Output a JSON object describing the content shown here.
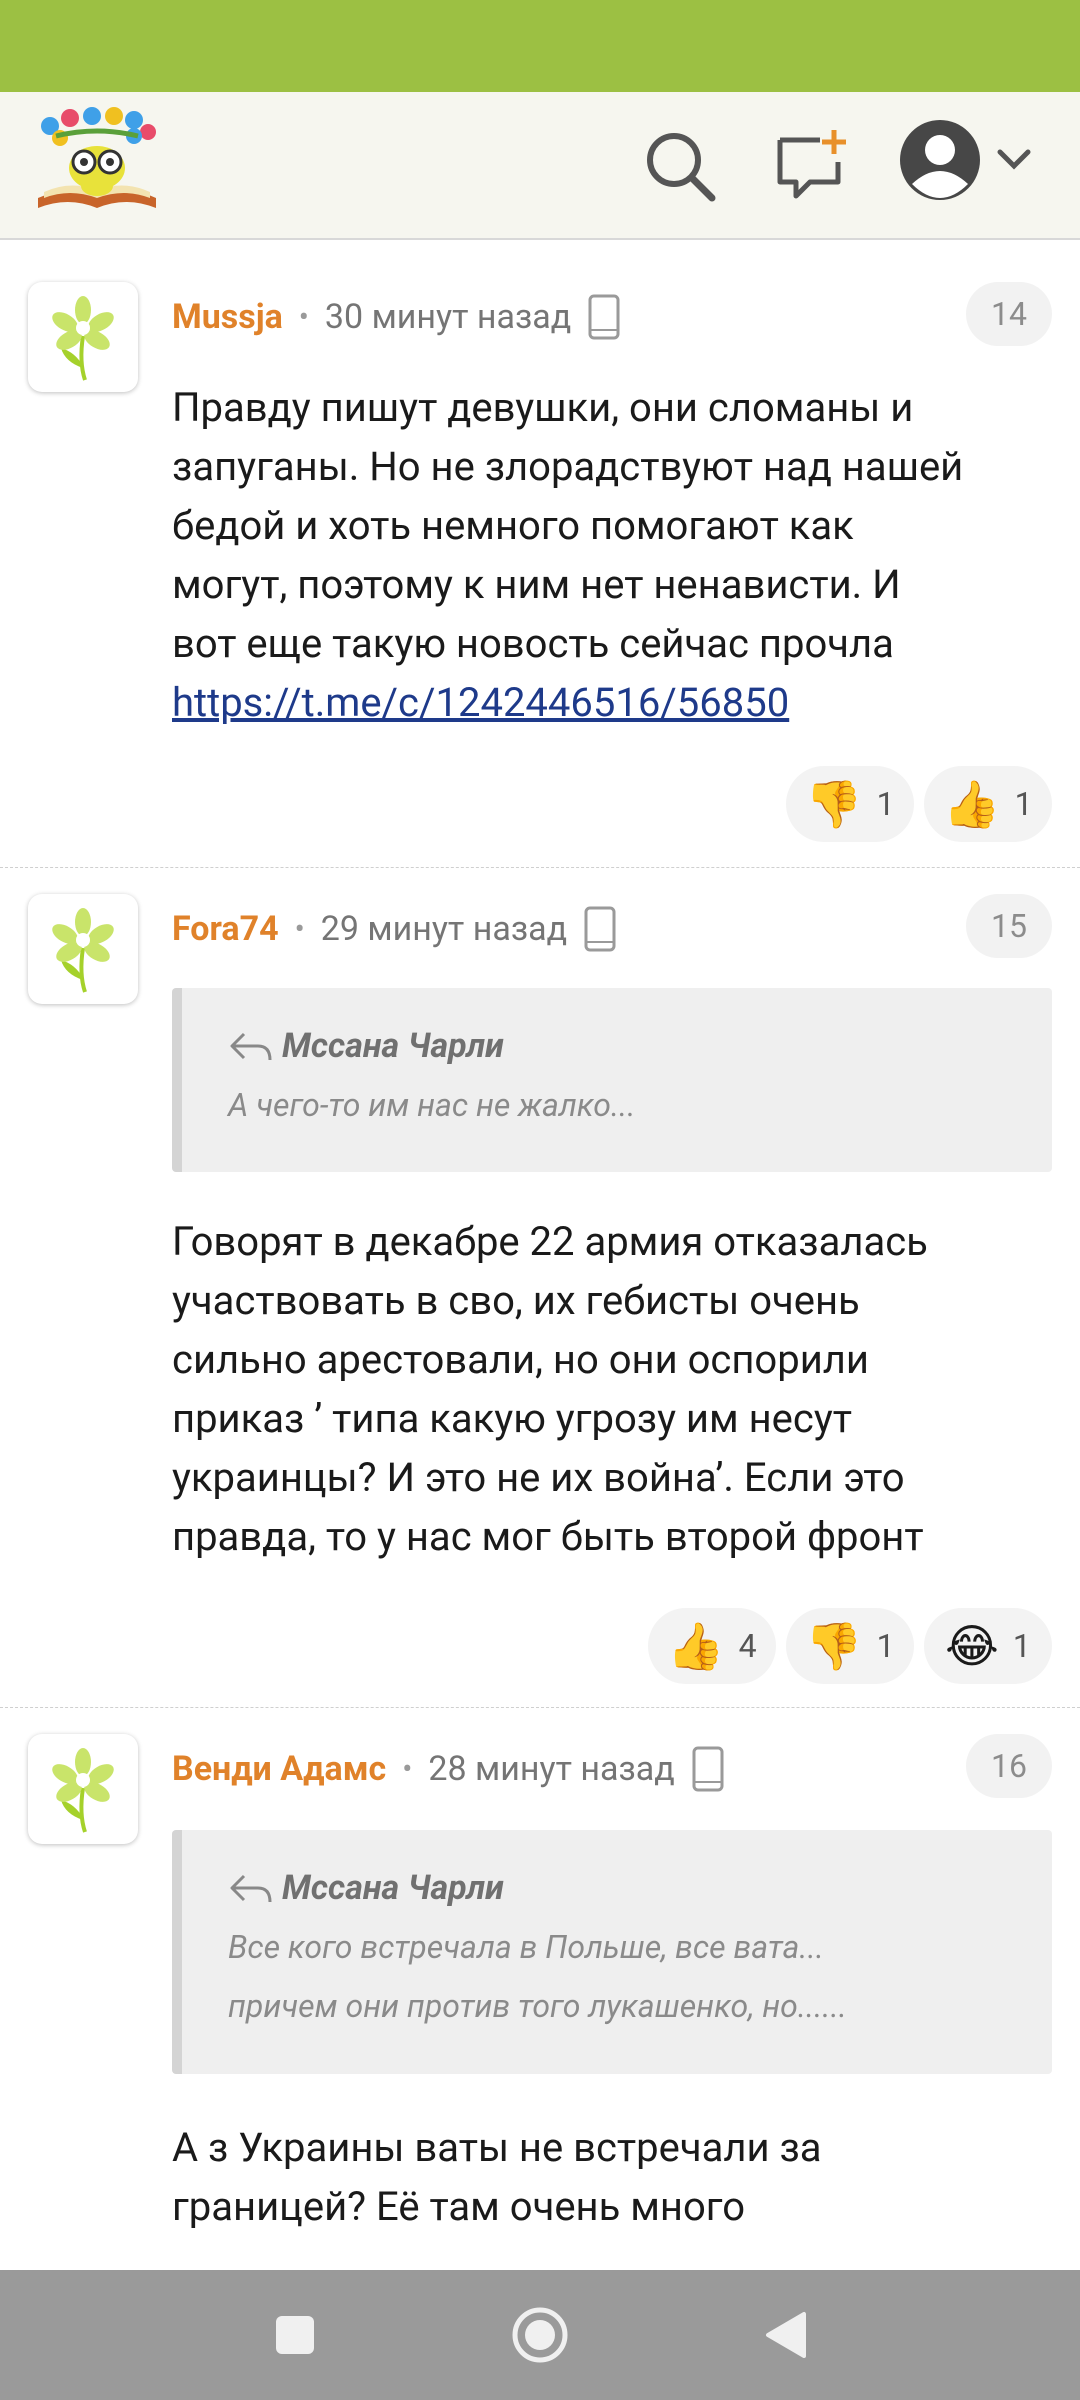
{
  "header": {
    "logo_name": "site-logo",
    "icons": [
      "search-icon",
      "new-message-icon",
      "avatar-icon",
      "chevron-down-icon"
    ]
  },
  "comments": [
    {
      "author": "Mussja",
      "time": "30 минут назад",
      "number": "14",
      "text_lines": [
        "Правду пишут девушки, они сломаны и",
        "запуганы. Но не злорадствуют над нашей",
        "бедой и хоть немного помогают как",
        "могут, поэтому к ним нет ненависти. И",
        "вот еще такую новость сейчас прочла"
      ],
      "link": "https://t.me/c/1242446516/56850",
      "reactions": [
        {
          "icon": "thumbs-down-icon",
          "emoji": "👎",
          "count": "1"
        },
        {
          "icon": "thumbs-up-icon",
          "emoji": "👍",
          "count": "1"
        }
      ]
    },
    {
      "author": "Fora74",
      "time": "29 минут назад",
      "number": "15",
      "quote": {
        "author": "Мссана Чарли",
        "lines": [
          "А чего-то им нас не жалко..."
        ]
      },
      "text_lines": [
        "Говорят в декабре 22 армия отказалась",
        "участвовать в сво, их гебисты очень",
        "сильно арестовали, но они оспорили",
        "приказ ’ типа какую угрозу им несут",
        "украинцы? И это не их война’. Если это",
        "правда, то у нас мог быть второй фронт"
      ],
      "reactions": [
        {
          "icon": "thumbs-up-icon",
          "emoji": "👍",
          "count": "4"
        },
        {
          "icon": "thumbs-down-icon",
          "emoji": "👎",
          "count": "1"
        },
        {
          "icon": "laughing-tears-icon",
          "emoji": "😂",
          "count": "1"
        }
      ]
    },
    {
      "author": "Венди Адамс",
      "time": "28 минут назад",
      "number": "16",
      "quote": {
        "author": "Мссана Чарли",
        "lines": [
          "Все кого встречала в Польше, все вата...",
          "причем они против того лукашенко, но......"
        ]
      },
      "text_lines": [
        "А з Украины ваты не встречали за",
        "границей? Её там очень много"
      ]
    }
  ],
  "nav": [
    "recent-apps-icon",
    "home-icon",
    "back-icon"
  ]
}
